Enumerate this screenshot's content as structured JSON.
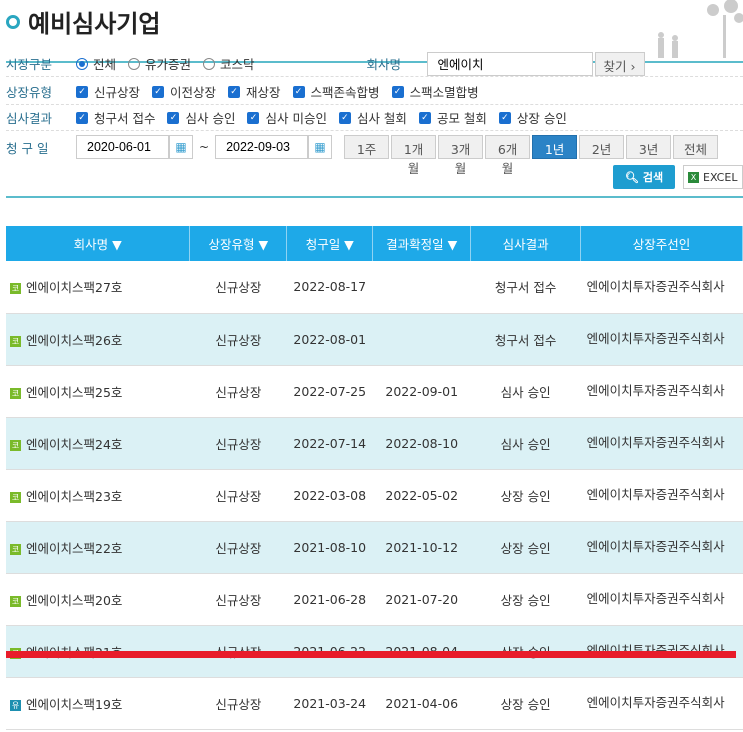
{
  "title": "예비심사기업",
  "filters": {
    "market": {
      "label": "시장구분",
      "options": [
        {
          "label": "전체",
          "selected": true
        },
        {
          "label": "유가증권",
          "selected": false
        },
        {
          "label": "코스닥",
          "selected": false
        }
      ]
    },
    "company": {
      "label": "회사명",
      "value": "엔에이치",
      "find_label": "찾기 ›"
    },
    "listing_type": {
      "label": "상장유형",
      "options": [
        "신규상장",
        "이전상장",
        "재상장",
        "스팩존속합병",
        "스팩소멸합병"
      ]
    },
    "result": {
      "label": "심사결과",
      "options": [
        "청구서 접수",
        "심사 승인",
        "심사 미승인",
        "심사 철회",
        "공모 철회",
        "상장 승인"
      ]
    },
    "date": {
      "label": "청 구 일",
      "from": "2020-06-01",
      "sep": "~",
      "to": "2022-09-03",
      "periods": [
        "1주",
        "1개월",
        "3개월",
        "6개월",
        "1년",
        "2년",
        "3년",
        "전체"
      ],
      "active_period": "1년"
    },
    "search_label": "검색",
    "excel_label": "EXCEL"
  },
  "colors": {
    "header": "#1ea9e8",
    "accent": "#2aa6c0",
    "strike": "#e81c2a"
  },
  "table": {
    "headers": [
      "회사명 ▼",
      "상장유형 ▼",
      "청구일 ▼",
      "결과확정일 ▼",
      "심사결과",
      "상장주선인"
    ],
    "rows": [
      {
        "market": "코",
        "name": "엔에이치스팩27호",
        "type": "신규상장",
        "req": "2022-08-17",
        "conf": "",
        "result": "청구서 접수",
        "lead": "엔에이치투자증권주식회사"
      },
      {
        "market": "코",
        "name": "엔에이치스팩26호",
        "type": "신규상장",
        "req": "2022-08-01",
        "conf": "",
        "result": "청구서 접수",
        "lead": "엔에이치투자증권주식회사"
      },
      {
        "market": "코",
        "name": "엔에이치스팩25호",
        "type": "신규상장",
        "req": "2022-07-25",
        "conf": "2022-09-01",
        "result": "심사 승인",
        "lead": "엔에이치투자증권주식회사"
      },
      {
        "market": "코",
        "name": "엔에이치스팩24호",
        "type": "신규상장",
        "req": "2022-07-14",
        "conf": "2022-08-10",
        "result": "심사 승인",
        "lead": "엔에이치투자증권주식회사"
      },
      {
        "market": "코",
        "name": "엔에이치스팩23호",
        "type": "신규상장",
        "req": "2022-03-08",
        "conf": "2022-05-02",
        "result": "상장 승인",
        "lead": "엔에이치투자증권주식회사"
      },
      {
        "market": "코",
        "name": "엔에이치스팩22호",
        "type": "신규상장",
        "req": "2021-08-10",
        "conf": "2021-10-12",
        "result": "상장 승인",
        "lead": "엔에이치투자증권주식회사"
      },
      {
        "market": "코",
        "name": "엔에이치스팩20호",
        "type": "신규상장",
        "req": "2021-06-28",
        "conf": "2021-07-20",
        "result": "상장 승인",
        "lead": "엔에이치투자증권주식회사"
      },
      {
        "market": "코",
        "name": "엔에이치스팩21호",
        "type": "신규상장",
        "req": "2021-06-22",
        "conf": "2021-08-04",
        "result": "상장 승인",
        "lead": "엔에이치투자증권주식회사"
      },
      {
        "market": "유",
        "name": "엔에이치스팩19호",
        "type": "신규상장",
        "req": "2021-03-24",
        "conf": "2021-04-06",
        "result": "상장 승인",
        "lead": "엔에이치투자증권주식회사"
      }
    ]
  }
}
